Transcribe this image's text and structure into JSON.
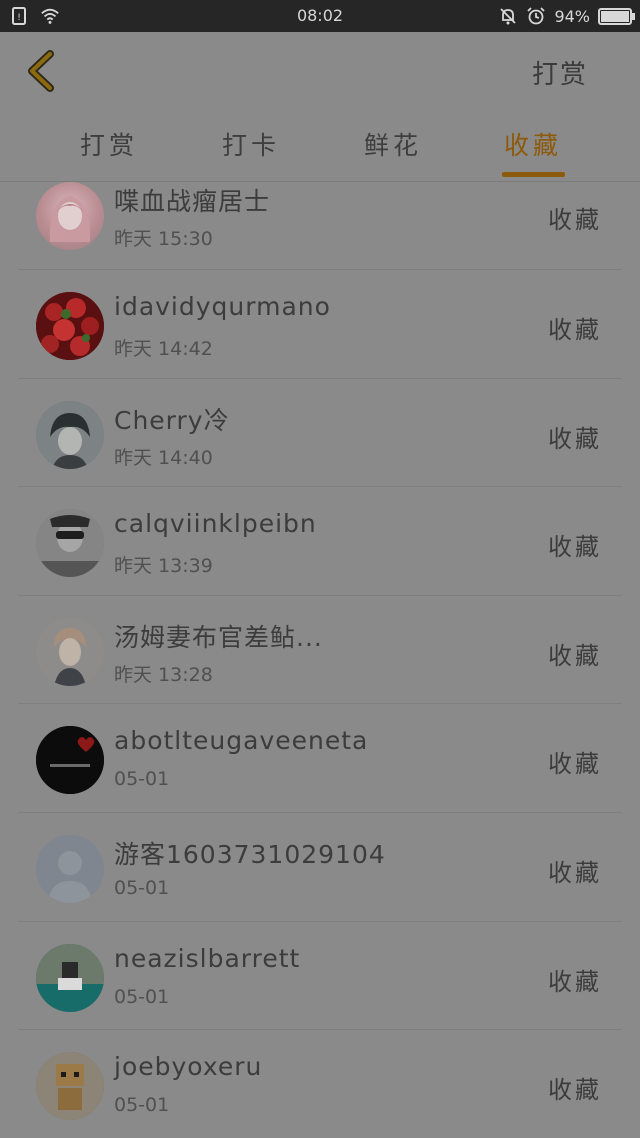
{
  "status_bar": {
    "time": "08:02",
    "battery": "94%",
    "battery_level": 0.94,
    "icons": [
      "sim-icon",
      "wifi-icon",
      "mute-bell-icon",
      "alarm-icon",
      "battery-icon"
    ]
  },
  "header": {
    "back_icon": "chevron-left-icon",
    "action_label": "打赏"
  },
  "tabs": [
    {
      "label": "打赏",
      "active": false
    },
    {
      "label": "打卡",
      "active": false
    },
    {
      "label": "鲜花",
      "active": false
    },
    {
      "label": "收藏",
      "active": true
    }
  ],
  "accent_color": "#8d5a0b",
  "items": [
    {
      "name": "喋血战瘤居士",
      "time": "昨天 15:30",
      "action": "收藏"
    },
    {
      "name": "idavidyqurmano",
      "time": "昨天 14:42",
      "action": "收藏"
    },
    {
      "name": "Cherry冷",
      "time": "昨天 14:40",
      "action": "收藏"
    },
    {
      "name": "calqviinklpeibn",
      "time": "昨天 13:39",
      "action": "收藏"
    },
    {
      "name": "汤姆妻布官差鲇...",
      "time": "昨天 13:28",
      "action": "收藏"
    },
    {
      "name": "abotlteugaveeneta",
      "time": "05-01",
      "action": "收藏"
    },
    {
      "name": "游客1603731029104",
      "time": "05-01",
      "action": "收藏"
    },
    {
      "name": "neazislbarrett",
      "time": "05-01",
      "action": "收藏"
    },
    {
      "name": "joebyoxeru",
      "time": "05-01",
      "action": "收藏"
    }
  ]
}
